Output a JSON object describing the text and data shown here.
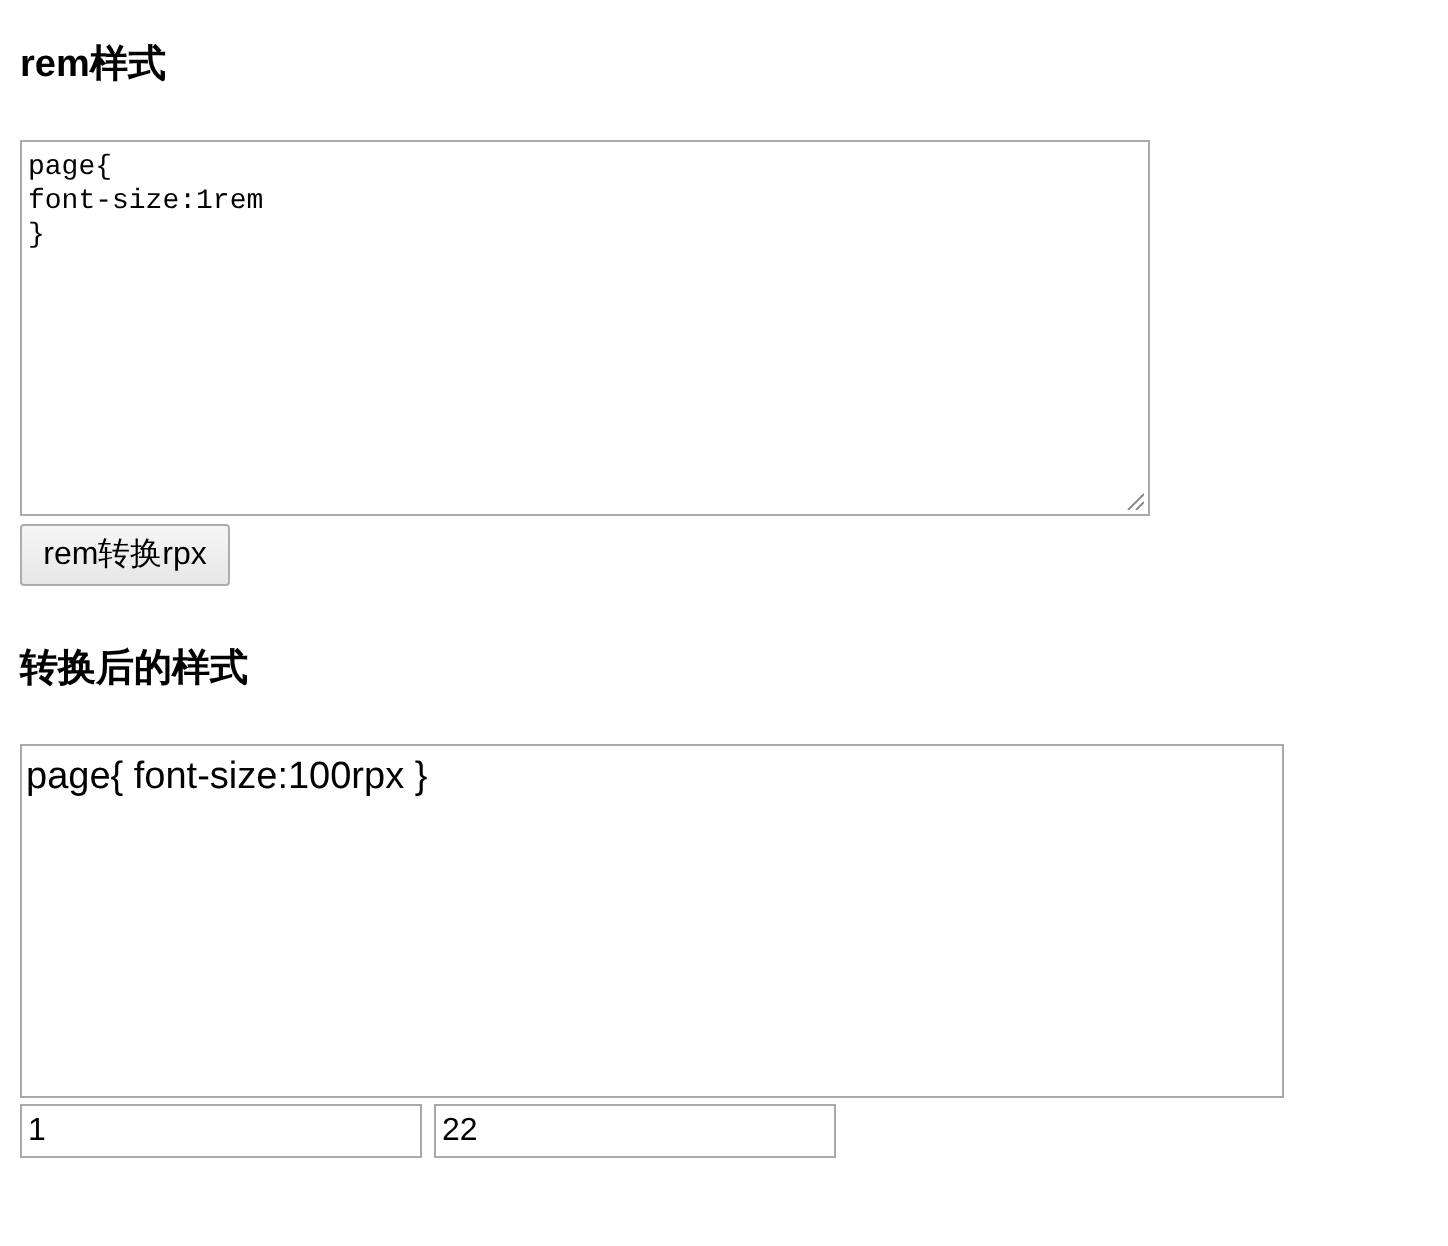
{
  "input_section": {
    "heading": "rem样式",
    "code_field": {
      "value": "page{\nfont-size:1rem\n}"
    },
    "convert_button": {
      "label": "rem转换rpx"
    }
  },
  "output_section": {
    "heading": "转换后的样式",
    "result": {
      "value": "page{ font-size:100rpx }"
    },
    "fields": [
      {
        "value": "1"
      },
      {
        "value": "22"
      }
    ]
  }
}
